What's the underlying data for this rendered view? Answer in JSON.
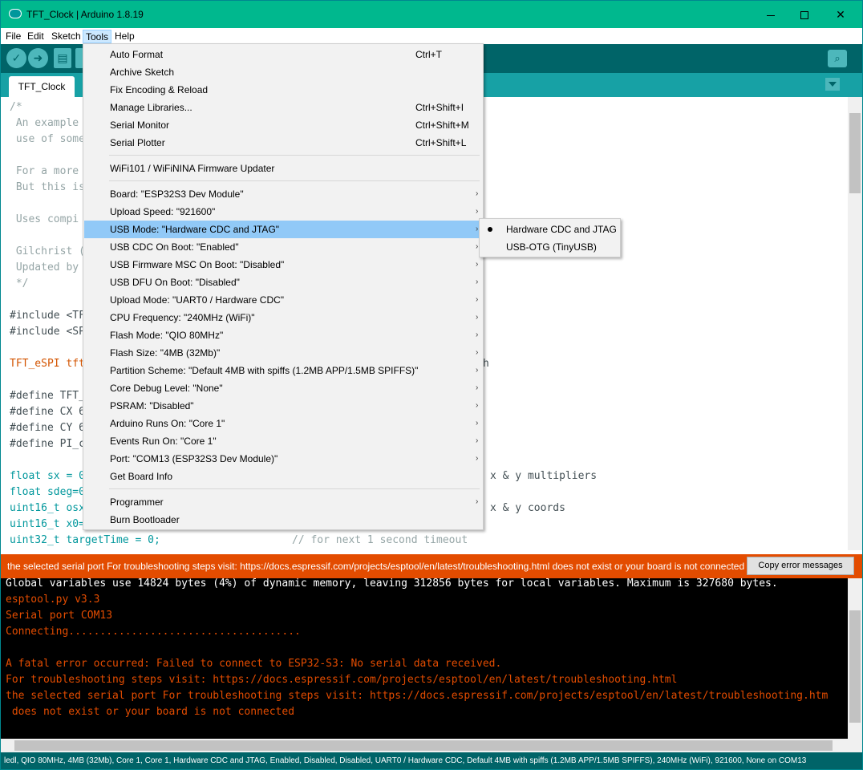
{
  "window": {
    "title": "TFT_Clock | Arduino 1.8.19"
  },
  "menubar": [
    "File",
    "Edit",
    "Sketch",
    "Tools",
    "Help"
  ],
  "toolbar": {
    "verify": "✓",
    "upload": "➜"
  },
  "tab": {
    "label": "TFT_Clock"
  },
  "code": [
    "/*",
    " An example",
    " use of some",
    "",
    " For a more",
    " But this is",
    "",
    " Uses compi",
    "",
    " Gilchrist (",
    " Updated by",
    " */",
    "",
    "#include <TF",
    "#include <SP",
    "",
    "TFT_eSPI tft",
    "",
    "#define TFT_",
    "#define CX 6",
    "#define CY 6",
    "#define PI_c",
    "",
    "float sx = 0",
    "float sdeg=0",
    "uint16_t osx",
    "uint16_t x0=",
    "uint32_t targetTime = 0;"
  ],
  "code_right": {
    "line_16": "h",
    "line_23": "x & y multipliers",
    "line_25": "x & y coords",
    "line_27": "// for next 1 second timeout"
  },
  "tools_menu": {
    "items": [
      {
        "label": "Auto Format",
        "shortcut": "Ctrl+T"
      },
      {
        "label": "Archive Sketch"
      },
      {
        "label": "Fix Encoding & Reload"
      },
      {
        "label": "Manage Libraries...",
        "shortcut": "Ctrl+Shift+I"
      },
      {
        "label": "Serial Monitor",
        "shortcut": "Ctrl+Shift+M"
      },
      {
        "label": "Serial Plotter",
        "shortcut": "Ctrl+Shift+L"
      },
      {
        "label": "WiFi101 / WiFiNINA Firmware Updater"
      },
      {
        "label": "Board: \"ESP32S3 Dev Module\""
      },
      {
        "label": "Upload Speed: \"921600\""
      },
      {
        "label": "USB Mode: \"Hardware CDC and JTAG\""
      },
      {
        "label": "USB CDC On Boot: \"Enabled\""
      },
      {
        "label": "USB Firmware MSC On Boot: \"Disabled\""
      },
      {
        "label": "USB DFU On Boot: \"Disabled\""
      },
      {
        "label": "Upload Mode: \"UART0 / Hardware CDC\""
      },
      {
        "label": "CPU Frequency: \"240MHz (WiFi)\""
      },
      {
        "label": "Flash Mode: \"QIO 80MHz\""
      },
      {
        "label": "Flash Size: \"4MB (32Mb)\""
      },
      {
        "label": "Partition Scheme: \"Default 4MB with spiffs (1.2MB APP/1.5MB SPIFFS)\""
      },
      {
        "label": "Core Debug Level: \"None\""
      },
      {
        "label": "PSRAM: \"Disabled\""
      },
      {
        "label": "Arduino Runs On: \"Core 1\""
      },
      {
        "label": "Events Run On: \"Core 1\""
      },
      {
        "label": "Port: \"COM13 (ESP32S3 Dev Module)\""
      },
      {
        "label": "Get Board Info"
      },
      {
        "label": "Programmer"
      },
      {
        "label": "Burn Bootloader"
      }
    ]
  },
  "usb_mode_submenu": {
    "items": [
      {
        "label": "Hardware CDC and JTAG",
        "selected": true
      },
      {
        "label": "USB-OTG (TinyUSB)",
        "selected": false
      }
    ]
  },
  "error_bar": {
    "message": "the selected serial port For troubleshooting steps visit: https://docs.espressif.com/projects/esptool/en/latest/troubleshooting.html does not exist or your board is not connected",
    "copy_button": "Copy error messages"
  },
  "console": [
    {
      "text": "Global variables use 14824 bytes (4%) of dynamic memory, leaving 312856 bytes for local variables. Maximum is 327680 bytes.",
      "color": "white"
    },
    {
      "text": "esptool.py v3.3",
      "color": "red"
    },
    {
      "text": "Serial port COM13",
      "color": "red"
    },
    {
      "text": "Connecting.....................................",
      "color": "red"
    },
    {
      "text": "",
      "color": "red"
    },
    {
      "text": "A fatal error occurred: Failed to connect to ESP32-S3: No serial data received.",
      "color": "red"
    },
    {
      "text": "For troubleshooting steps visit: https://docs.espressif.com/projects/esptool/en/latest/troubleshooting.html",
      "color": "red"
    },
    {
      "text": "the selected serial port For troubleshooting steps visit: https://docs.espressif.com/projects/esptool/en/latest/troubleshooting.htm",
      "color": "red"
    },
    {
      "text": " does not exist or your board is not connected",
      "color": "red"
    }
  ],
  "footer": "ledl, QIO 80MHz, 4MB (32Mb), Core 1, Core 1, Hardware CDC and JTAG, Enabled, Disabled, Disabled, UART0 / Hardware CDC, Default 4MB with spiffs (1.2MB APP/1.5MB SPIFFS), 240MHz (WiFi), 921600, None on COM13",
  "colors": {
    "titlebar": "#00b88e",
    "toolbar": "#006468",
    "tabbar": "#17a1a5",
    "error": "#e34c00",
    "menu_highlight": "#91c9f7"
  }
}
